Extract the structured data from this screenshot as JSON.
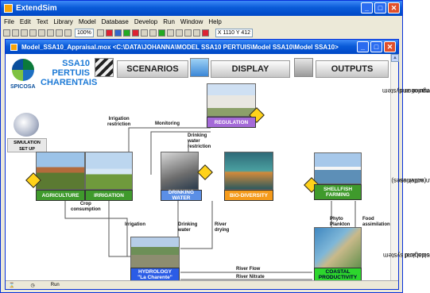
{
  "app": {
    "title": "ExtendSim",
    "menu": [
      "File",
      "Edit",
      "Text",
      "Library",
      "Model",
      "Database",
      "Develop",
      "Run",
      "Window",
      "Help"
    ],
    "zoom": "100%",
    "coords": "X 1110  Y 412"
  },
  "doc": {
    "title": "Model_SSA10_Appraisal.mox   <C:\\DATA\\JOHANNA\\MODEL SSA10 PERTUIS\\Model SSA10\\Model SSA10>"
  },
  "logo": {
    "org": "SPICOSA",
    "title1": "SSA10",
    "title2": "PERTUIS",
    "title3": "CHARENTAIS"
  },
  "nav": {
    "scenarios": "SCENARIOS",
    "display": "DISPLAY",
    "outputs": "OUTPUTS"
  },
  "sim": {
    "label1": "SIMULATION",
    "label2": "SET UP"
  },
  "nodes": {
    "regulation": "REGULATION",
    "agriculture": "AGRICULTURE",
    "irrigation": "IRRIGATION",
    "drinking_water": "DRINKING WATER",
    "biodiversity": "BIO-DIVERSITY",
    "shellfish1": "SHELLFISH",
    "shellfish2": "FARMING",
    "hydrology1": "HYDROLOGY",
    "hydrology2": "\"La Charente\"",
    "coastal1": "COASTAL",
    "coastal2": "PRODUCTIVITY"
  },
  "links": {
    "irrigation_restriction": [
      "Irrigation",
      "restriction"
    ],
    "monitoring": "Monitoring",
    "dw_restriction": [
      "Drinking",
      "water",
      "restriction"
    ],
    "crop_consumption": [
      "Crop",
      "consumption"
    ],
    "irrigation": "Irrigation",
    "drinking_water": [
      "Drinking",
      "water"
    ],
    "river_drying": [
      "River",
      "drying"
    ],
    "phyto_plankton": [
      "Phyto",
      "Plankton"
    ],
    "food_assimilation": [
      "Food",
      "assimilation"
    ],
    "river_flow": "River Flow",
    "river_nitrate": "River Nitrate"
  },
  "status": {
    "run": "Run"
  },
  "side": {
    "gov": [
      "Governance and",
      "Regulation system"
    ],
    "human": [
      "Human activities",
      "(water uses)"
    ],
    "phys": [
      "Physical and",
      "ecological system"
    ]
  },
  "colors": {
    "regulation": "#a46ad8",
    "agriculture": "#3f9a2c",
    "drinking_water": "#5b8fe6",
    "biodiversity": "#f59a1a",
    "hydrology": "#2b5ce6",
    "coastal": "#2dd62d"
  }
}
